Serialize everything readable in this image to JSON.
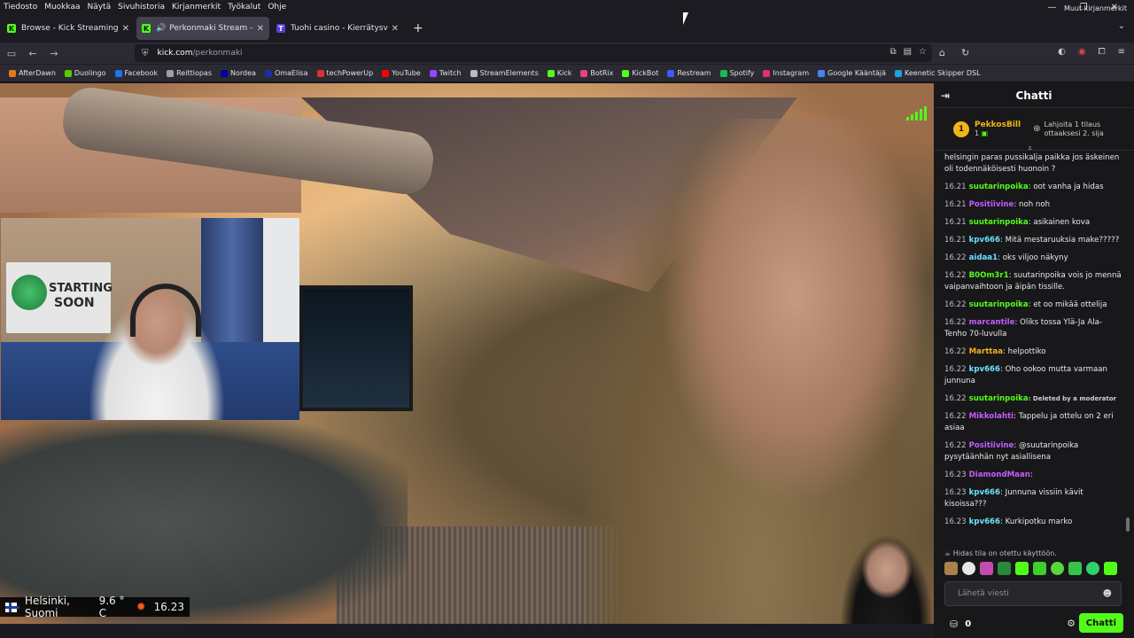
{
  "menubar": [
    "Tiedosto",
    "Muokkaa",
    "Näytä",
    "Sivuhistoria",
    "Kirjanmerkit",
    "Työkalut",
    "Ohje"
  ],
  "window_controls": [
    "—",
    "❐",
    "✕"
  ],
  "tabs": [
    {
      "title": "Browse - Kick Streaming",
      "fav": "K",
      "fav_color": "#53fc18"
    },
    {
      "title": "Perkonmaki Stream - Watch",
      "fav": "K",
      "fav_color": "#53fc18"
    },
    {
      "title": "Tuohi casino - Kierrätysvapaita",
      "fav": "T",
      "fav_color": "#5a3bd8"
    }
  ],
  "url": {
    "domain": "kick.com",
    "path": "/perkonmaki"
  },
  "bookmarks": [
    {
      "label": "AfterDawn",
      "color": "#e07a1a"
    },
    {
      "label": "Duolingo",
      "color": "#58cc02"
    },
    {
      "label": "Facebook",
      "color": "#1877f2"
    },
    {
      "label": "Reittiopas",
      "color": "#9aa0a6"
    },
    {
      "label": "Nordea",
      "color": "#0000a0"
    },
    {
      "label": "OmaElisa",
      "color": "#1f2fa0"
    },
    {
      "label": "techPowerUp",
      "color": "#d9342b"
    },
    {
      "label": "YouTube",
      "color": "#ff0000"
    },
    {
      "label": "Twitch",
      "color": "#9146ff"
    },
    {
      "label": "StreamElements",
      "color": "#bbbbbb"
    },
    {
      "label": "Kick",
      "color": "#53fc18"
    },
    {
      "label": "BotRix",
      "color": "#e0447a"
    },
    {
      "label": "KickBot",
      "color": "#53fc18"
    },
    {
      "label": "Restream",
      "color": "#3d5afe"
    },
    {
      "label": "Spotify",
      "color": "#1db954"
    },
    {
      "label": "Instagram",
      "color": "#e1306c"
    },
    {
      "label": "Google Kääntäjä",
      "color": "#4285f4"
    },
    {
      "label": "Keenetic Skipper DSL",
      "color": "#20a0e0"
    }
  ],
  "bookmarks_other": "Muut kirjanmerkit",
  "poster": {
    "line1": "STARTING",
    "line2": "SOON"
  },
  "weather": {
    "location": "Helsinki, Suomi",
    "temp": "9.6 ° C",
    "time": "16.23"
  },
  "chat": {
    "title": "Chatti",
    "pinned": {
      "rank": "1",
      "user": "PekkosBill",
      "count": "1",
      "gift_text": "Lahjoita 1 tilaus ottaaksesi 2. sija"
    },
    "messages": [
      {
        "time": "",
        "user": "",
        "color": "#e9e9ec",
        "text": "helsingin paras pussikalja paikka jos äskeinen oli todennäköisesti huonoin ?"
      },
      {
        "time": "16.21",
        "user": "suutarinpoika",
        "color": "#53fc18",
        "text": ": oot vanha ja hidas"
      },
      {
        "time": "16.21",
        "user": "Positiivine",
        "color": "#c55cff",
        "text": ": noh noh"
      },
      {
        "time": "16.21",
        "user": "suutarinpoika",
        "color": "#53fc18",
        "text": ": asikainen kova"
      },
      {
        "time": "16.21",
        "user": "kpv666",
        "color": "#6ce0ff",
        "text": ": Mitä mestaruuksia make?????"
      },
      {
        "time": "16.22",
        "user": "aidaa1",
        "color": "#6ce0ff",
        "text": ": oks viljoo näkyny"
      },
      {
        "time": "16.22",
        "user": "B0Om3r1",
        "color": "#53fc18",
        "text": ": suutarinpoika vois jo mennä vaipanvaihtoon ja äipän tissille."
      },
      {
        "time": "16.22",
        "user": "suutarinpoika",
        "color": "#53fc18",
        "text": ": et oo mikää ottelija"
      },
      {
        "time": "16.22",
        "user": "marcantile",
        "color": "#c55cff",
        "text": ": Oliks tossa Ylä-Ja Ala-Tenho 70-luvulla"
      },
      {
        "time": "16.22",
        "user": "Marttaa",
        "color": "#f0b51a",
        "text": ": helpottiko"
      },
      {
        "time": "16.22",
        "user": "kpv666",
        "color": "#6ce0ff",
        "text": ": Oho ookoo mutta varmaan junnuna"
      },
      {
        "time": "16.22",
        "user": "suutarinpoika",
        "color": "#53fc18",
        "text": ": Deleted by a moderator"
      },
      {
        "time": "16.22",
        "user": "Mikkolahti",
        "color": "#c55cff",
        "text": ": Tappelu ja ottelu on 2 eri asiaa"
      },
      {
        "time": "16.22",
        "user": "Positiivine",
        "color": "#c55cff",
        "text": ": @suutarinpoika pysytäänhän nyt asiallisena"
      },
      {
        "time": "16.23",
        "user": "DiamondMaan",
        "color": "#c55cff",
        "text": ":"
      },
      {
        "time": "16.23",
        "user": "kpv666",
        "color": "#6ce0ff",
        "text": ": Junnuna vissiin kävit kisoissa???"
      },
      {
        "time": "16.23",
        "user": "kpv666",
        "color": "#6ce0ff",
        "text": ": Kurkipotku marko"
      }
    ],
    "slow_mode": "Hidas tila on otettu käyttöön.",
    "input_placeholder": "Lähetä viesti",
    "points": "0",
    "send_label": "Chatti"
  }
}
